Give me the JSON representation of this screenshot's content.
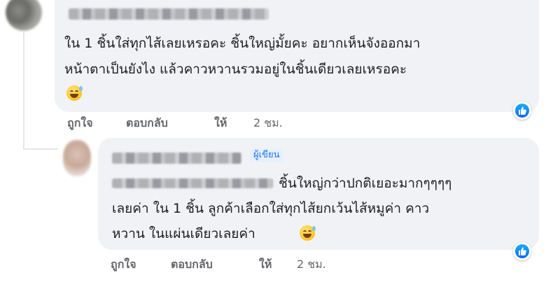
{
  "comment": {
    "text_lines": [
      "ใน 1 ชิ้นใส่ทุกไส้เลยเหรอคะ ชิ้นใหญ่มั้ยคะ อยากเห็นจังออกมา",
      "หน้าตาเป็นยังไง แล้วคาวหวานรวมอยู่ในชิ้นเดียวเลยเหรอคะ"
    ],
    "emoji": "grinning-sweat-emoji",
    "actions": {
      "like": "ถูกใจ",
      "reply": "ตอบกลับ",
      "share": "ให้",
      "time": "2 ชม."
    }
  },
  "reply": {
    "author_badge": "ผู้เขียน",
    "text_lines": [
      "ชิ้นใหญ่กว่าปกติเยอะมากๆๆๆๆ",
      "เลยค่า ใน 1 ชิ้น ลูกค้าเลือกใส่ทุกไส้ยกเว้นไส้หมูค่า คาว",
      "หวาน ในแผ่นเดียวเลยค่า"
    ],
    "emoji": "grinning-sweat-emoji",
    "actions": {
      "like": "ถูกใจ",
      "reply": "ตอบกลับ",
      "share": "ให้",
      "time": "2 ชม."
    }
  },
  "colors": {
    "bubble": "#f0f2f5",
    "accent": "#1877f2",
    "muted": "#65676b"
  }
}
